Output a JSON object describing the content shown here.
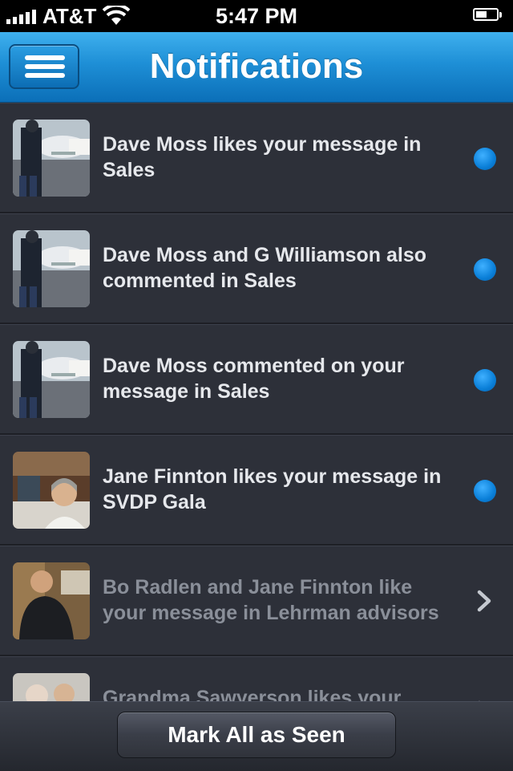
{
  "status_bar": {
    "carrier": "AT&T",
    "time": "5:47 PM",
    "battery_level": 0.55
  },
  "nav": {
    "title": "Notifications",
    "menu_icon": "hamburger-menu-icon"
  },
  "notifications": [
    {
      "text": "Dave Moss likes your message in Sales",
      "unread": true,
      "avatar": "airport"
    },
    {
      "text": "Dave Moss and G Williamson also commented in Sales",
      "unread": true,
      "avatar": "airport"
    },
    {
      "text": "Dave Moss commented on your message in Sales",
      "unread": true,
      "avatar": "airport"
    },
    {
      "text": "Jane Finnton likes your message in SVDP Gala",
      "unread": true,
      "avatar": "restaurant"
    },
    {
      "text": "Bo Radlen and Jane Finnton like your message in Lehrman advisors",
      "unread": false,
      "avatar": "party"
    },
    {
      "text": "Grandma Sawyerson likes your",
      "unread": false,
      "avatar": "couple"
    }
  ],
  "bottom": {
    "mark_all_label": "Mark All as Seen"
  },
  "colors": {
    "accent": "#1e8fd6",
    "unread_dot": "#0a7fd8",
    "row_bg": "#2d3039"
  }
}
